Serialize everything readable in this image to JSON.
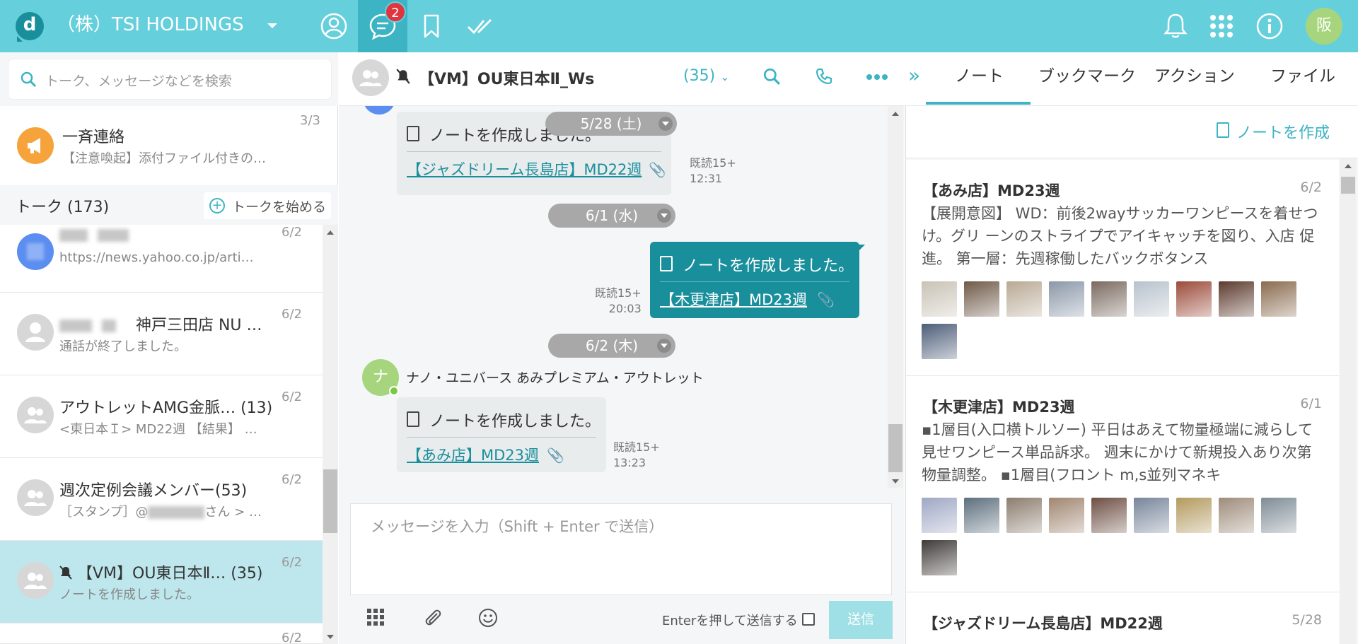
{
  "topbar": {
    "logo": "d",
    "org_name": "（株）TSI HOLDINGS",
    "message_badge": "2",
    "user_avatar": "阪",
    "accent_color": "#66cfdc",
    "icons": [
      "person-icon",
      "chat-icon",
      "bookmark-icon",
      "check-icon",
      "bell-icon",
      "apps-grid-icon",
      "info-icon"
    ]
  },
  "left": {
    "search_placeholder": "トーク、メッセージなどを検索",
    "announcement": {
      "title": "一斉連絡",
      "subtitle": "【注意喚起】添付ファイル付きの…",
      "count": "3/3"
    },
    "talk_header": {
      "title": "トーク (173)",
      "start_label": "トークを始める"
    },
    "conversations": [
      {
        "title": "",
        "subtitle": "https://news.yahoo.co.jp/arti…",
        "date": "6/2",
        "avatar": "blue"
      },
      {
        "title": "神戸三田店 NU …",
        "subtitle": "通話が終了しました。",
        "date": "6/2",
        "avatar": "gray"
      },
      {
        "title": "アウトレットAMG金脈… (13)",
        "subtitle": "<東日本Ｉ> MD22週 【結果】 …",
        "date": "6/2",
        "avatar": "group"
      },
      {
        "title": "週次定例会議メンバー(53)",
        "subtitle": "［スタンプ］@",
        "subtitle_suffix": "さん > …",
        "date": "6/2",
        "avatar": "group"
      },
      {
        "title": "【VM】OU東日本Ⅱ… (35)",
        "subtitle": "ノートを作成しました。",
        "date": "6/2",
        "avatar": "group",
        "selected": true
      },
      {
        "title": "",
        "subtitle": "",
        "date": "6/2",
        "avatar": "gray"
      }
    ]
  },
  "chat": {
    "title": "【VM】OU東日本Ⅱ_Ws",
    "member_count": "(35)",
    "dates": [
      "5/28 (土)",
      "6/1 (水)",
      "6/2 (木)"
    ],
    "messages": [
      {
        "text": "ノートを作成しました。",
        "link": "【ジャズドリーム長島店】MD22週",
        "read": "既読15+",
        "time": "12:31",
        "mine": false
      },
      {
        "text": "ノートを作成しました。",
        "link": "【木更津店】MD23週",
        "read": "既読15+",
        "time": "20:03",
        "mine": true
      },
      {
        "sender_initial": "ナ",
        "sender": "ナノ・ユニバース あみプレミアム・アウトレット",
        "text": "ノートを作成しました。",
        "link": "【あみ店】MD23週",
        "read": "既読15+",
        "time": "13:23",
        "mine": false
      }
    ],
    "input_placeholder": "メッセージを入力（Shift + Enter で送信）",
    "enter_to_send_label": "Enterを押して送信する",
    "send_label": "送信"
  },
  "right": {
    "tabs": [
      "ノート",
      "ブックマーク",
      "アクション",
      "ファイル"
    ],
    "active_tab": 0,
    "create_note_label": "ノートを作成",
    "notes": [
      {
        "title": "【あみ店】MD23週",
        "date": "6/2",
        "body": "【展開意図】 WD：前後2wayサッカーワンピースを着せつけ。グリ ーンのストライプでアイキャッチを図り、入店 促進。 第一層：先週稼働したバックボタンス",
        "thumb_colors": [
          "#c9c2b6",
          "#6f5a48",
          "#b9a994",
          "#8b97a8",
          "#7a6a60",
          "#b8c2cc",
          "#9b4b3a",
          "#5c3a2e",
          "#8a6b4f",
          "#4d5d78"
        ]
      },
      {
        "title": "【木更津店】MD23週",
        "date": "6/1",
        "body": "▪1層目(入口横トルソー) 平日はあえて物量極端に減らして見せワンピース単品訴求。 週末にかけて新規投入あり次第物量調整。 ▪1層目(フロント m,s並列マネキ",
        "thumb_colors": [
          "#9fa7c4",
          "#5d6f7d",
          "#8c7d6f",
          "#a08670",
          "#6d4f43",
          "#77859a",
          "#b39a5f",
          "#9e8c7a",
          "#7f8c95",
          "#3f3a38"
        ]
      },
      {
        "title": "【ジャズドリーム長島店】MD22週",
        "date": "5/28",
        "body": "",
        "thumb_colors": []
      }
    ]
  }
}
